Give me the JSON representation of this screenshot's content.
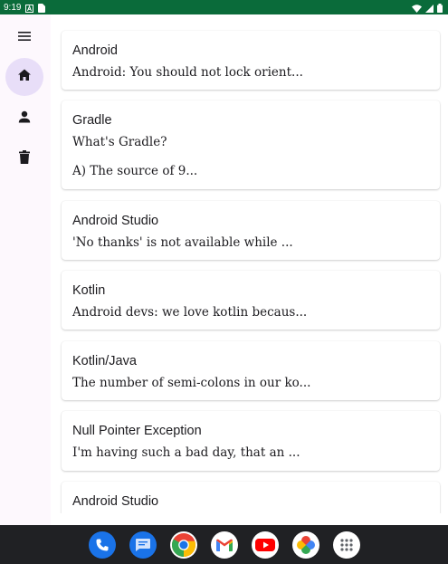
{
  "status_bar": {
    "time": "9:19",
    "icons": [
      "notification-a-icon",
      "sim-card-icon",
      "wifi-icon",
      "signal-icon",
      "battery-icon"
    ]
  },
  "nav_rail": {
    "items": [
      {
        "name": "menu-icon",
        "active": false
      },
      {
        "name": "home-icon",
        "active": true
      },
      {
        "name": "person-icon",
        "active": false
      },
      {
        "name": "delete-icon",
        "active": false
      }
    ],
    "active_color": "#e8def8"
  },
  "cards": [
    {
      "title": "Android",
      "body": "Android: You should not lock orient..."
    },
    {
      "title": "Gradle",
      "body": "What's Gradle?",
      "body2": "A) The source of 9..."
    },
    {
      "title": "Android Studio",
      "body": "'No thanks' is not available while ..."
    },
    {
      "title": "Kotlin",
      "body": "Android devs: we love kotlin becaus..."
    },
    {
      "title": "Kotlin/Java",
      "body": "The number of semi-colons in our ko..."
    },
    {
      "title": "Null Pointer Exception",
      "body": "I'm having such a bad day, that an ..."
    },
    {
      "title": "Android Studio",
      "body": ""
    }
  ],
  "dock": {
    "apps": [
      "phone-app-icon",
      "messages-app-icon",
      "chrome-app-icon",
      "gmail-app-icon",
      "youtube-app-icon",
      "photos-app-icon",
      "app-drawer-icon"
    ]
  },
  "colors": {
    "status_bar": "#0a6b3a",
    "rail_background": "#fdf8fd",
    "dock_background": "#202124"
  }
}
